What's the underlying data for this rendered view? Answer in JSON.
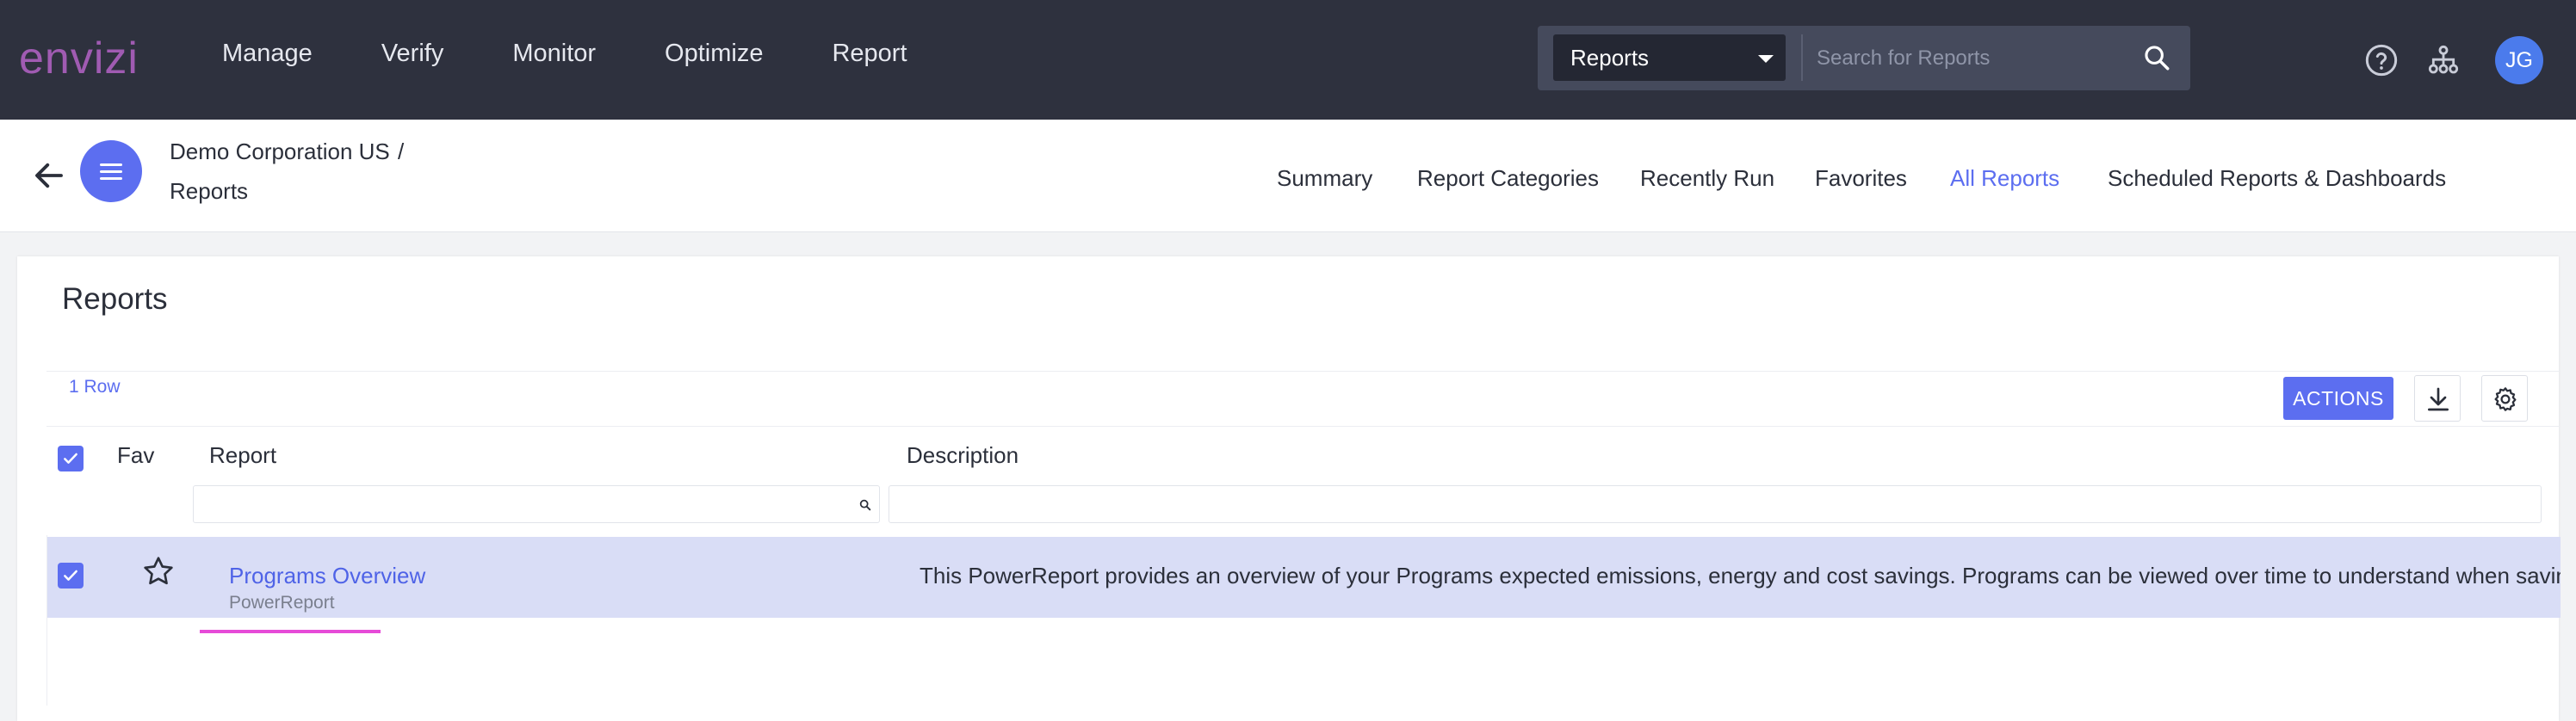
{
  "brand": {
    "logo_text": "envizi",
    "logo_color": "#a05bb2",
    "accent": "#5c6ef0",
    "topbar_bg": "#2e313e"
  },
  "main_nav": [
    {
      "label": "Manage"
    },
    {
      "label": "Verify"
    },
    {
      "label": "Monitor"
    },
    {
      "label": "Optimize"
    },
    {
      "label": "Report"
    }
  ],
  "search": {
    "scope": "Reports",
    "placeholder": "Search for Reports",
    "icon": "search-icon"
  },
  "utility": {
    "help_icon": "help-icon",
    "hierarchy_icon": "hierarchy-icon",
    "avatar_initials": "JG"
  },
  "breadcrumb": {
    "org": "Demo Corporation US",
    "separator": "/",
    "page": "Reports"
  },
  "sub_nav": [
    {
      "label": "Summary",
      "active": false
    },
    {
      "label": "Report Categories",
      "active": false
    },
    {
      "label": "Recently Run",
      "active": false
    },
    {
      "label": "Favorites",
      "active": false
    },
    {
      "label": "All Reports",
      "active": true
    },
    {
      "label": "Scheduled Reports & Dashboards",
      "active": false
    }
  ],
  "card": {
    "title": "Reports",
    "row_count": "1 Row",
    "actions_label": "ACTIONS",
    "download_icon": "download-icon",
    "settings_icon": "gear-icon"
  },
  "grid": {
    "columns": {
      "fav": "Fav",
      "report": "Report",
      "description": "Description"
    },
    "filters": {
      "report": "",
      "description": ""
    },
    "rows": [
      {
        "selected": true,
        "favorite": false,
        "report": "Programs Overview",
        "type": "PowerReport",
        "description": "This PowerReport provides an overview of your Programs expected emissions, energy and cost savings. Programs can be viewed over time to understand when savings"
      }
    ]
  }
}
